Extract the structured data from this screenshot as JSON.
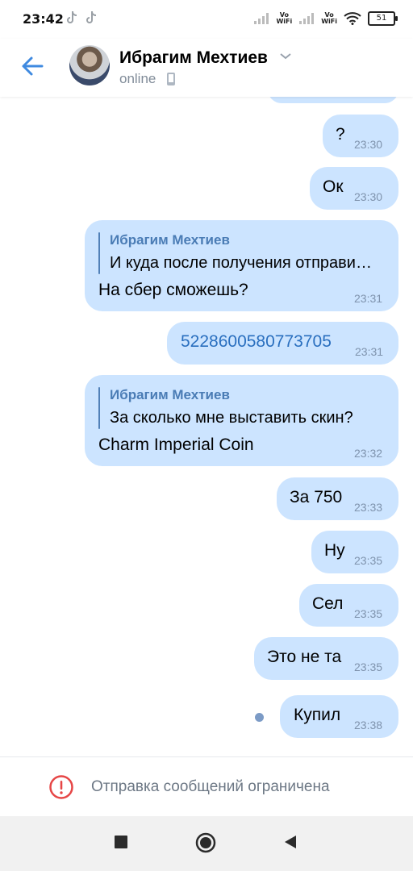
{
  "status_bar": {
    "time": "23:42",
    "vo_label": "Vo",
    "wifi_label": "WiFi",
    "battery": "51"
  },
  "header": {
    "contact_name": "Ибрагим Мехтиев",
    "status": "online"
  },
  "messages": [
    {
      "text": "?",
      "time": "23:30"
    },
    {
      "text": "Ок",
      "time": "23:30"
    },
    {
      "reply_name": "Ибрагим Мехтиев",
      "reply_text": "И куда после получения отправи…",
      "text": "На сбер сможешь?",
      "time": "23:31"
    },
    {
      "text": "5228600580773705",
      "time": "23:31"
    },
    {
      "reply_name": "Ибрагим Мехтиев",
      "reply_text": "За сколько мне выставить скин?",
      "text": "Charm Imperial Coin",
      "time": "23:32"
    },
    {
      "text": "За 750",
      "time": "23:33"
    },
    {
      "text": "Ну",
      "time": "23:35"
    },
    {
      "text": "Сел",
      "time": "23:35"
    },
    {
      "text": "Это не та",
      "time": "23:35"
    },
    {
      "text": "Купил",
      "time": "23:38"
    }
  ],
  "footer": {
    "restriction_text": "Отправка сообщений ограничена"
  },
  "colors": {
    "bubble": "#cce4ff",
    "accent": "#2a6fbf",
    "warning": "#e64646"
  }
}
